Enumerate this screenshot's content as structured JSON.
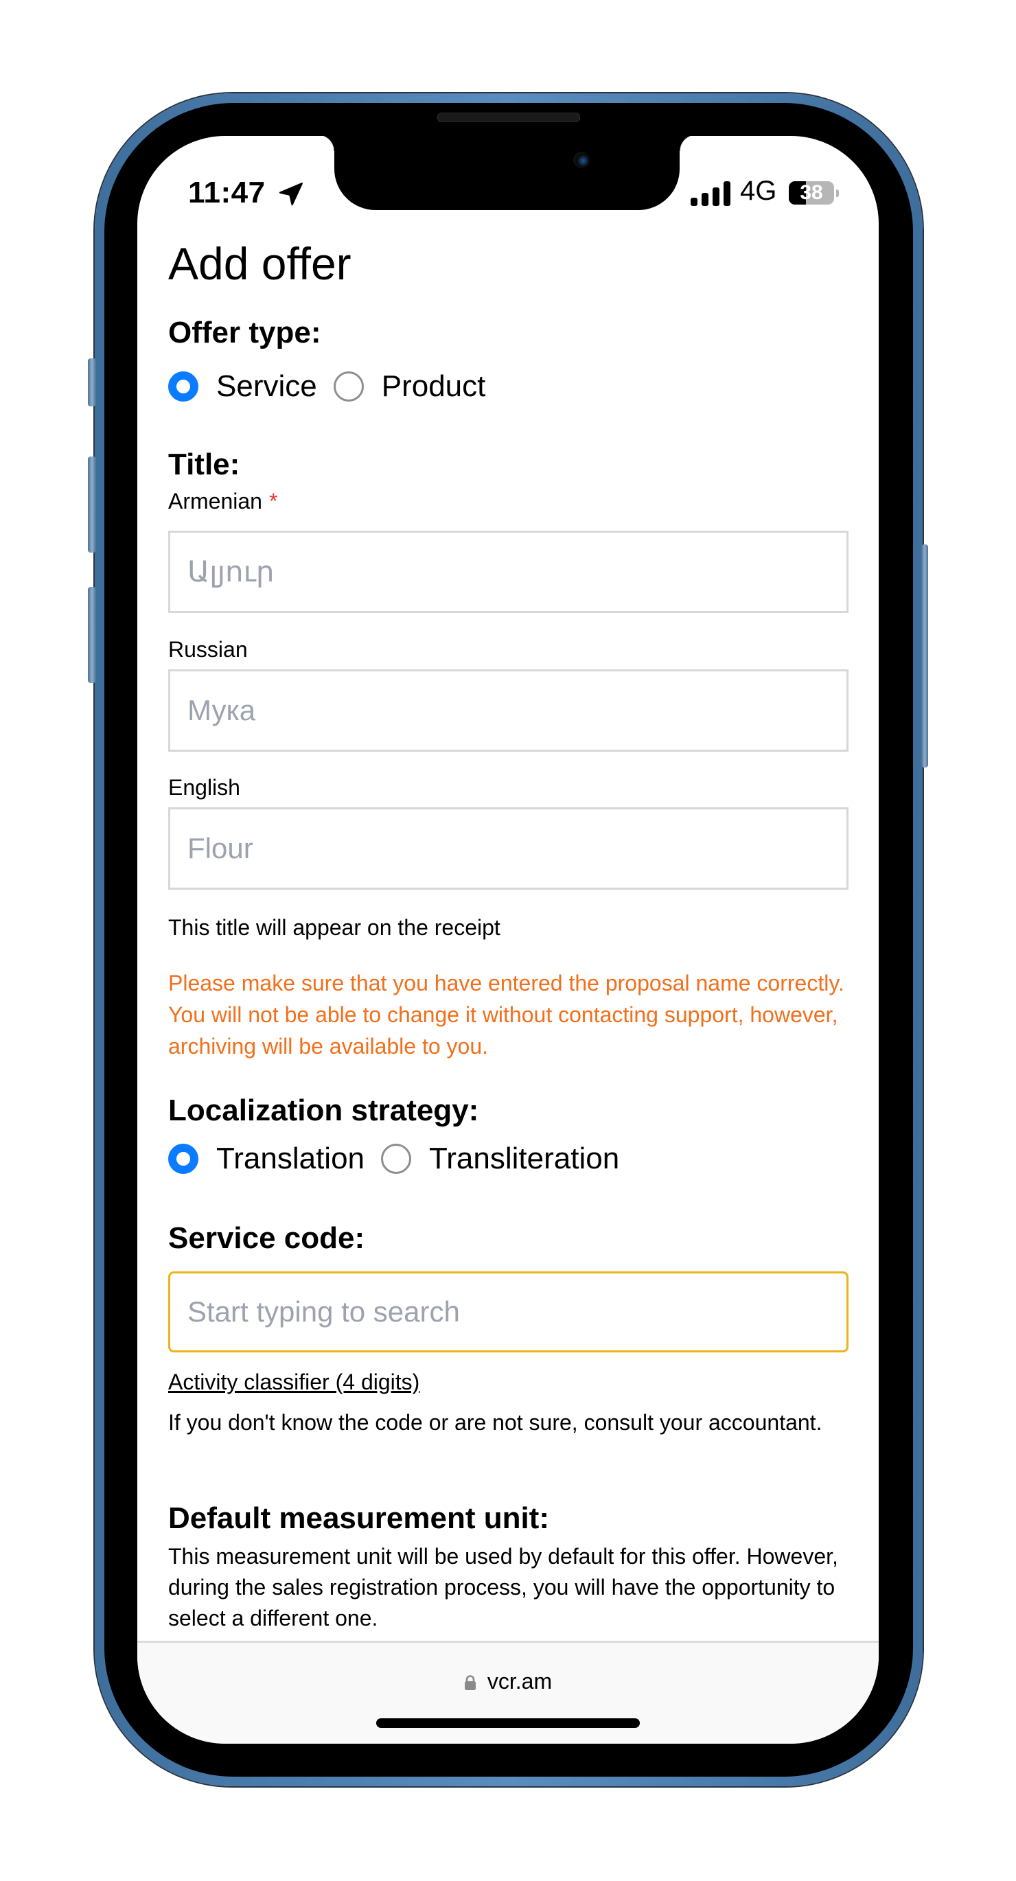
{
  "status_bar": {
    "time": "11:47",
    "network": "4G",
    "battery_percent": 38,
    "battery_label": "38",
    "icons": [
      "location-arrow-icon",
      "signal-bars-icon",
      "battery-icon"
    ]
  },
  "page": {
    "title": "Add offer"
  },
  "offer_type": {
    "heading": "Offer type:",
    "options": [
      {
        "label": "Service",
        "selected": true
      },
      {
        "label": "Product",
        "selected": false
      }
    ]
  },
  "title_section": {
    "heading": "Title:",
    "fields": [
      {
        "label": "Armenian",
        "required_mark": "*",
        "placeholder": "Ալյուր",
        "value": ""
      },
      {
        "label": "Russian",
        "placeholder": "Мука",
        "value": ""
      },
      {
        "label": "English",
        "placeholder": "Flour",
        "value": ""
      }
    ],
    "hint": "This title will appear on the receipt",
    "warning": "Please make sure that you have entered the proposal name correctly. You will not be able to change it without contacting support, however, archiving will be available to you."
  },
  "localization": {
    "heading": "Localization strategy:",
    "options": [
      {
        "label": "Translation",
        "selected": true
      },
      {
        "label": "Transliteration",
        "selected": false
      }
    ]
  },
  "service_code": {
    "heading": "Service code:",
    "placeholder": "Start typing to search",
    "value": "",
    "link": "Activity classifier (4 digits)",
    "help": "If you don't know the code or are not sure, consult your accountant."
  },
  "measurement": {
    "heading": "Default measurement unit:",
    "description": "This measurement unit will be used by default for this offer. However, during the sales registration process, you will have the opportunity to select a different one."
  },
  "browser": {
    "url": "vcr.am"
  },
  "colors": {
    "accent": "#0b7bff",
    "warning": "#f26f1c",
    "focus_border": "#eab51b",
    "required": "#e53935",
    "phone_frame": "#4a7aab"
  }
}
